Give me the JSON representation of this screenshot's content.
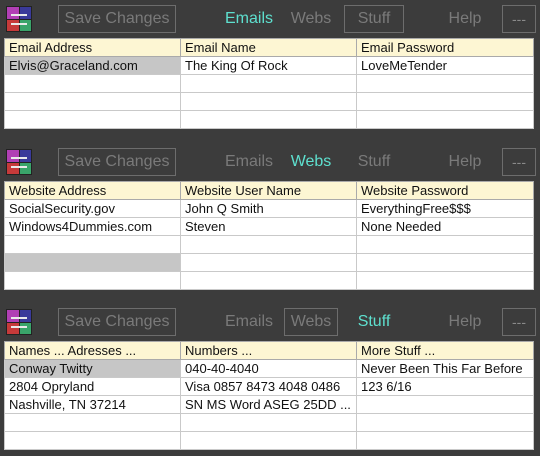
{
  "toolbar": {
    "save_label": "Save Changes",
    "tabs": [
      "Emails",
      "Webs",
      "Stuff"
    ],
    "help_label": "Help",
    "menu_label": "---"
  },
  "panels": [
    {
      "active_tab": "Emails",
      "headers": [
        "Email Address",
        "Email Name",
        "Email Password"
      ],
      "rows": [
        [
          "Elvis@Graceland.com",
          "The King Of Rock",
          "LoveMeTender"
        ],
        [
          "",
          "",
          ""
        ],
        [
          "",
          "",
          ""
        ],
        [
          "",
          "",
          ""
        ]
      ]
    },
    {
      "active_tab": "Webs",
      "headers": [
        "Website Address",
        "Website User Name",
        "Website Password"
      ],
      "rows": [
        [
          "SocialSecurity.gov",
          "John Q Smith",
          "EverythingFree$$$"
        ],
        [
          "Windows4Dummies.com",
          "Steven",
          "None Needed"
        ],
        [
          "",
          "",
          ""
        ],
        [
          "",
          "",
          ""
        ],
        [
          "",
          "",
          ""
        ]
      ]
    },
    {
      "active_tab": "Stuff",
      "headers": [
        "Names ... Adresses ...",
        "Numbers ...",
        "More Stuff ..."
      ],
      "rows": [
        [
          "Conway Twitty",
          "040-40-4040",
          "Never Been This Far Before"
        ],
        [
          "2804 Opryland",
          "Visa 0857 8473 4048 0486",
          "123 6/16"
        ],
        [
          "Nashville, TN 37214",
          "SN MS Word ASEG 25DD ...",
          ""
        ],
        [
          "",
          "",
          ""
        ],
        [
          "",
          "",
          ""
        ]
      ]
    }
  ],
  "colors": {
    "background": "#3c3c3c",
    "active_tab": "#5ee0cf",
    "inactive_text": "#7a7a7a",
    "header_bg": "#fdf6d3",
    "selected_cell": "#c6c6c6"
  }
}
